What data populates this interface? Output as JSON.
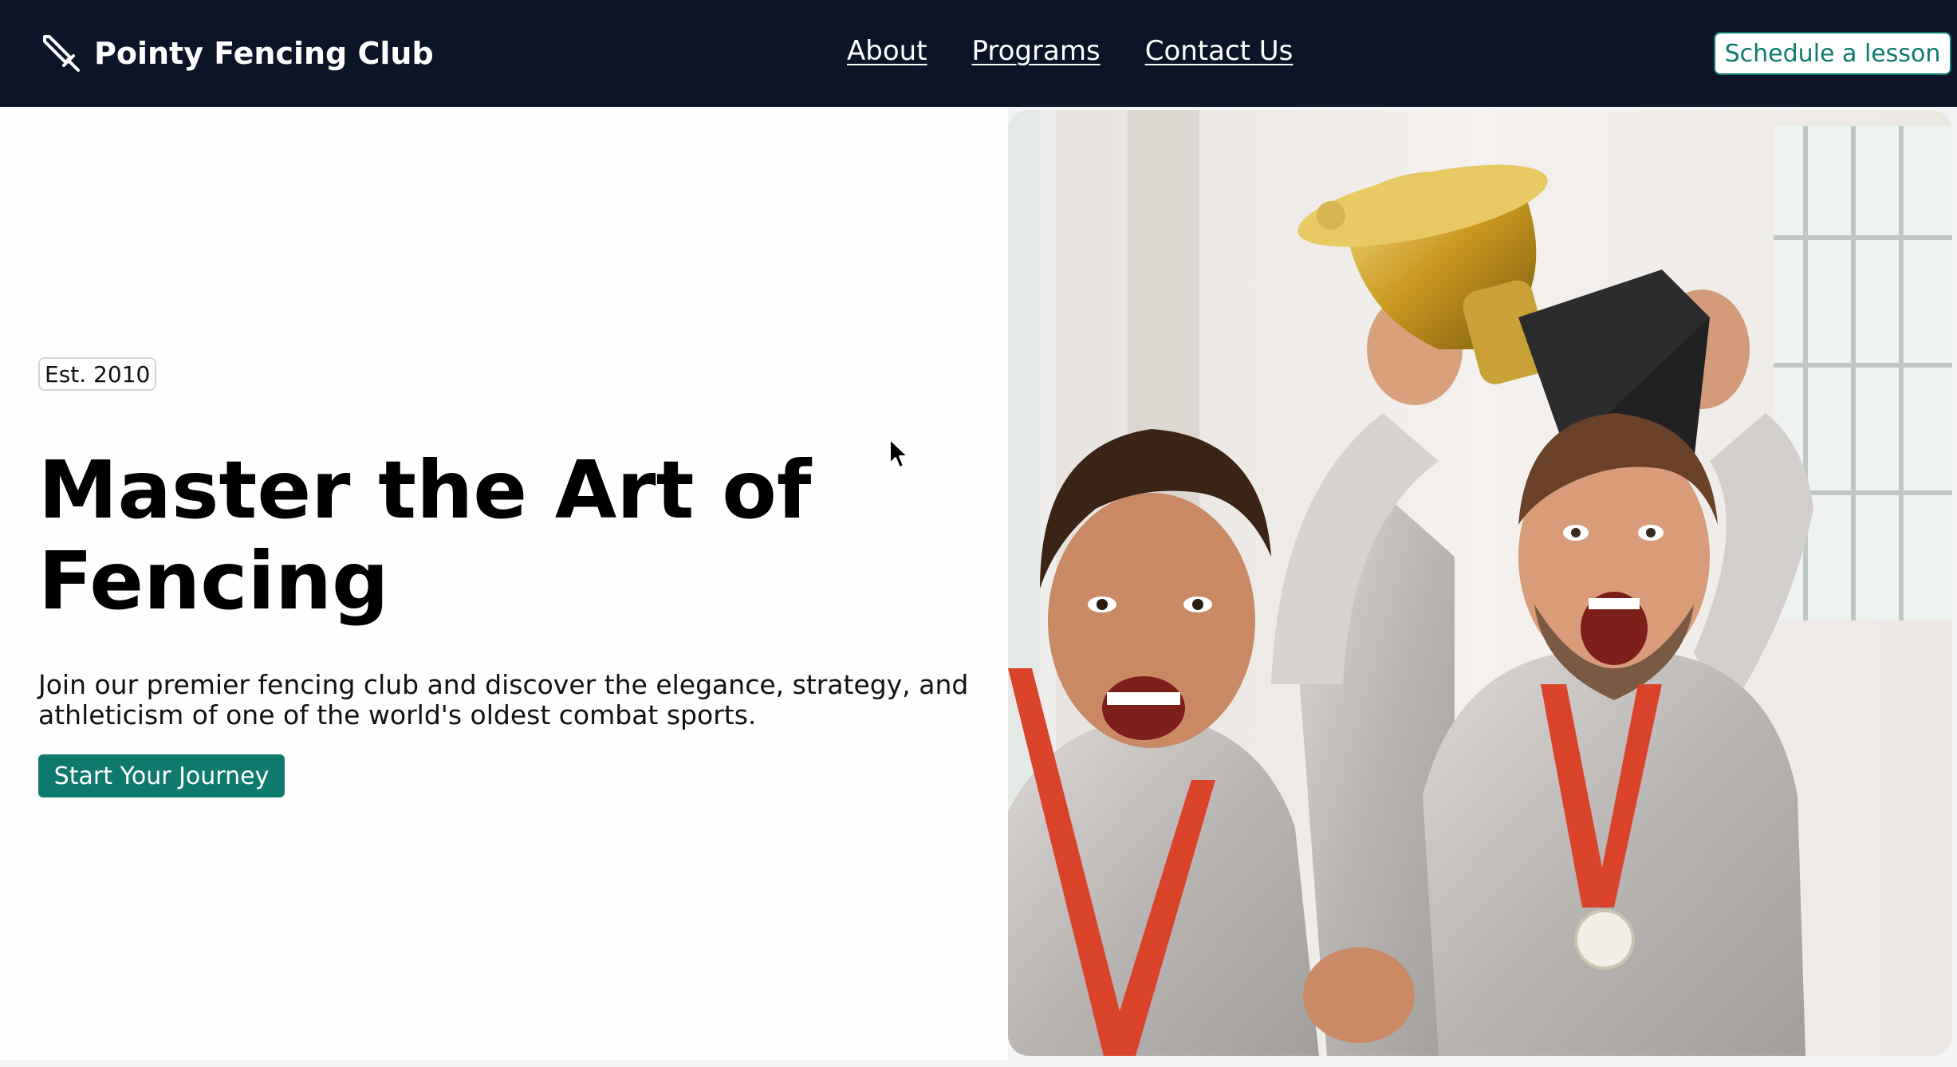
{
  "header": {
    "brand_name": "Pointy Fencing Club",
    "brand_icon": "sword-icon",
    "nav": [
      {
        "label": "About"
      },
      {
        "label": "Programs"
      },
      {
        "label": "Contact Us"
      }
    ],
    "cta_label": "Schedule a lesson"
  },
  "hero": {
    "badge": "Est. 2010",
    "title": "Master the Art of Fencing",
    "subtitle": "Join our premier fencing club and discover the elegance, strategy, and athleticism of one of the world's oldest combat sports.",
    "button_label": "Start Your Journey",
    "image": "two-fencers-celebrating-with-trophy-photo"
  },
  "colors": {
    "header_bg": "#0c1428",
    "accent": "#0e7a6e",
    "page_bg": "#fdfefe",
    "text": "#000000"
  }
}
